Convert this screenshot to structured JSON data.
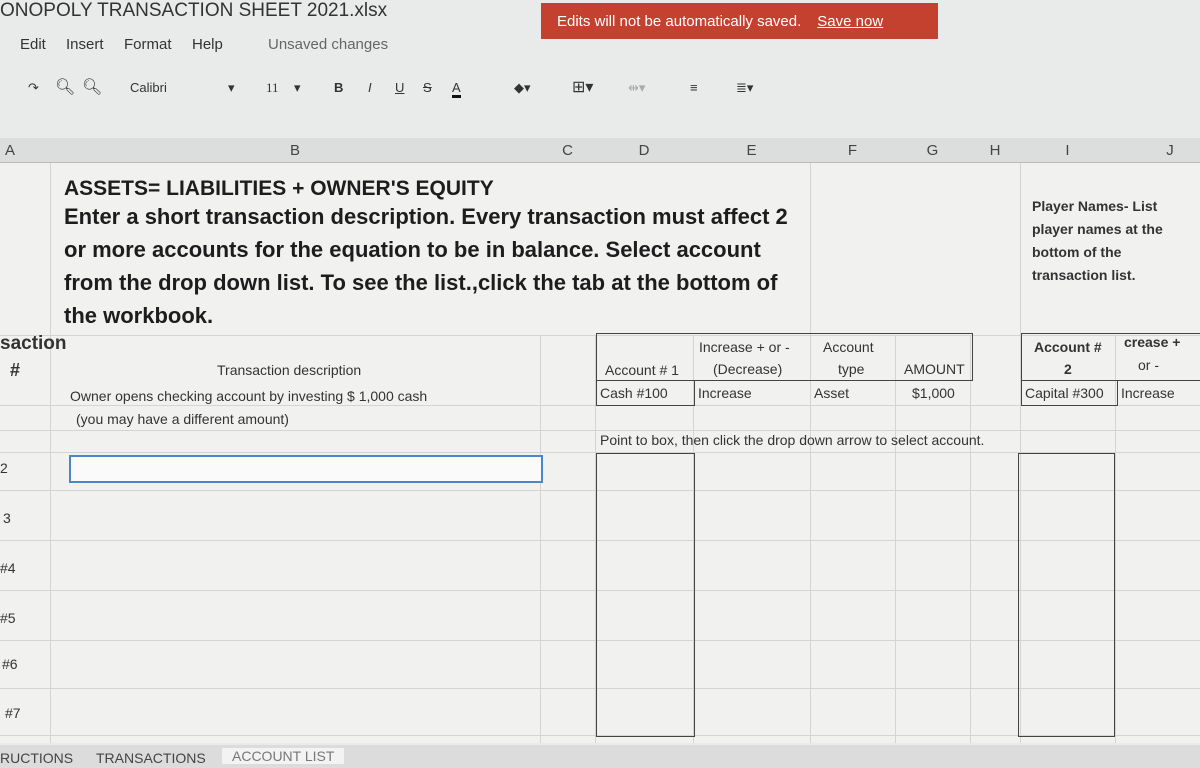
{
  "window": {
    "title": "ONOPOLY TRANSACTION SHEET 2021.xlsx",
    "status": "Unsaved changes"
  },
  "menu": [
    "Edit",
    "Insert",
    "Format",
    "Help"
  ],
  "banner": {
    "message": "Edits will not be automatically saved.",
    "action": "Save now",
    "color": "#c4412f"
  },
  "toolbar": {
    "font": "Calibri",
    "size": "11",
    "bold": "B",
    "italic": "I",
    "underline": "U",
    "strike": "S",
    "color": "A"
  },
  "columns": [
    "A",
    "B",
    "C",
    "D",
    "E",
    "F",
    "G",
    "H",
    "I",
    "J"
  ],
  "sheet": {
    "heading": "ASSETS= LIABILITIES + OWNER'S EQUITY",
    "instructions": "Enter a short transaction description. Every transaction must affect 2 or more accounts for the equation to be in balance. Select account from the drop down list. To see the list.,click the tab at the bottom of the workbook.",
    "player_note": "Player Names- List player names at the bottom of the transaction list.",
    "row_label_a": "saction",
    "row_label_hash": "#",
    "hdr_desc": "Transaction description",
    "hdr_acct1": "Account # 1",
    "hdr_incdec": "Increase + or -",
    "hdr_incdec2": "(Decrease)",
    "hdr_type": "Account",
    "hdr_type2": "type",
    "hdr_amount": "AMOUNT",
    "hdr_acct2": "Account #",
    "hdr_acct2b": "2",
    "hdr_inc2": "crease +",
    "hdr_inc2b": "or -",
    "row1": {
      "desc": "Owner opens checking account by investing $ 1,000 cash",
      "desc2": "(you may have a different amount)",
      "acct1": "Cash #100",
      "incdec": "Increase",
      "type": "Asset",
      "amount": "$1,000",
      "acct2": "Capital #300",
      "inc2": "Increase"
    },
    "hint": "Point to box, then click the drop down arrow  to select account.",
    "row_numbers": [
      "2",
      "3",
      "#4",
      "#5",
      "#6",
      "#7"
    ]
  },
  "tabs": [
    "RUCTIONS",
    "TRANSACTIONS",
    "ACCOUNT LIST"
  ]
}
